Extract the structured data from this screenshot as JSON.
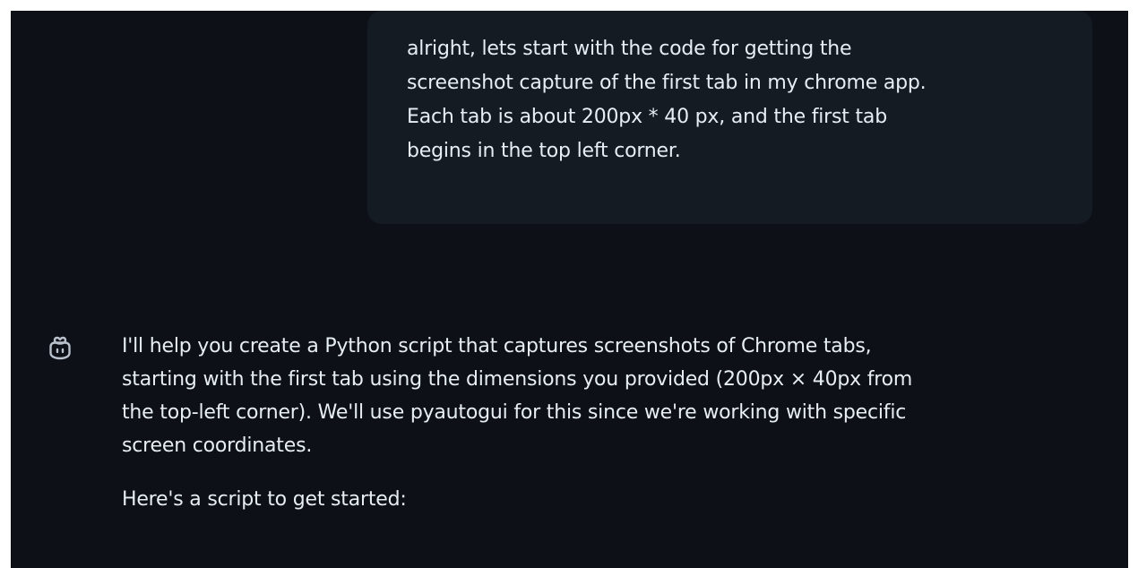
{
  "user_message": {
    "text": "alright, lets start with the code for getting the\nscreenshot capture of the first tab in my chrome app.\nEach tab is about 200px *  40 px, and the first tab\nbegins in the top left corner."
  },
  "assistant_message": {
    "avatar_icon": "copilot-icon",
    "paragraphs": [
      "I'll help you create a Python script that captures screenshots of Chrome tabs,\nstarting with the first tab using the dimensions you provided (200px × 40px from\nthe top-left corner). We'll use pyautogui for this since we're working with specific\nscreen coordinates.",
      "Here's a script to get started:"
    ]
  },
  "colors": {
    "background": "#0d1117",
    "user_bubble": "#151b23",
    "text": "#e6edf3",
    "icon": "#b9c1cc"
  }
}
